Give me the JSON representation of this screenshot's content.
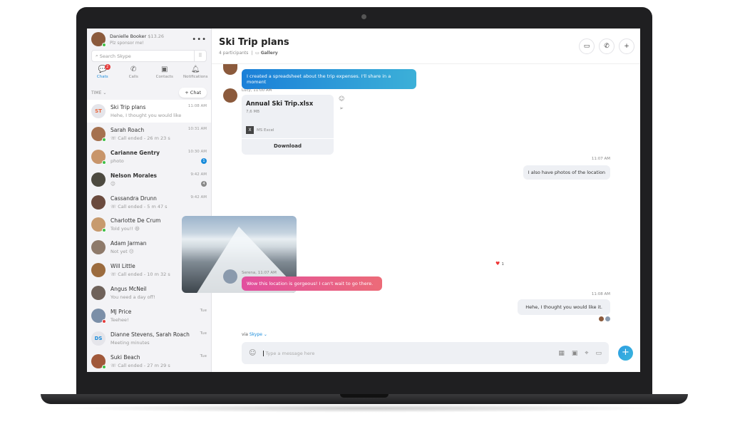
{
  "profile": {
    "name": "Danielle Booker",
    "balance": "$13.26",
    "mood": "Plz sponsor me!"
  },
  "search": {
    "placeholder": "Search Skype"
  },
  "tabs": [
    {
      "label": "Chats",
      "badge": "2"
    },
    {
      "label": "Calls"
    },
    {
      "label": "Contacts"
    },
    {
      "label": "Notifications"
    }
  ],
  "sort_label": "TIME",
  "new_chat_label": "+ Chat",
  "conversations": [
    {
      "name": "Ski Trip plans",
      "initials": "ST",
      "time": "11:08 AM",
      "preview": "Hehe, I thought you would like",
      "color": "#e5e5ea",
      "textcolor": "#e8663c"
    },
    {
      "name": "Sarah Roach",
      "time": "10:31 AM",
      "preview": "Call ended - 26 m 23 s",
      "color": "#a5714f",
      "status": "online"
    },
    {
      "name": "Carianne Gentry",
      "time": "10:30 AM",
      "preview": "photo",
      "unread": "1",
      "bold": true,
      "color": "#c8956a",
      "status": "online"
    },
    {
      "name": "Nelson Morales",
      "time": "9:42 AM",
      "preview": "😉",
      "unread": "4",
      "bold": true,
      "color": "#4d4a40"
    },
    {
      "name": "Cassandra Drunn",
      "time": "9:42 AM",
      "preview": "Call ended - 5 m 47 s",
      "color": "#6b4b3e"
    },
    {
      "name": "Charlotte De Crum",
      "time": "Wed",
      "preview": "Told you!! 😆",
      "color": "#c79a6e",
      "status": "online"
    },
    {
      "name": "Adam Jarman",
      "time": "Wed",
      "preview": "Not yet 😐",
      "color": "#8e7a6a"
    },
    {
      "name": "Will Little",
      "time": "Wed",
      "preview": "Call ended - 10 m 32 s",
      "color": "#9b6b3e"
    },
    {
      "name": "Angus McNeil",
      "time": "Wed",
      "preview": "You need a day off!",
      "color": "#6f625a"
    },
    {
      "name": "MJ Price",
      "time": "Tue",
      "preview": "Teehee!",
      "color": "#7b8fa8",
      "status": "busy"
    },
    {
      "name": "Dianne Stevens, Sarah Roach",
      "initials": "DS",
      "time": "Tue",
      "preview": "Meeting minutes",
      "color": "#e5e5ea",
      "textcolor": "#1a8cdb"
    },
    {
      "name": "Suki Beach",
      "time": "Tue",
      "preview": "Call ended - 27 m 29 s",
      "color": "#a0583a",
      "status": "online"
    }
  ],
  "chat": {
    "title": "Ski Trip plans",
    "participants": "4 participants",
    "gallery": "Gallery",
    "msg1": {
      "text": "I created a spreadsheet about the trip expenses. I'll share in a moment"
    },
    "file": {
      "meta": "Lucy, 11:00 AM",
      "name": "Annual Ski Trip.xlsx",
      "size": "7,6 MB",
      "type": "MS Excel",
      "download": "Download"
    },
    "msg2": {
      "time": "11:07 AM",
      "text": "I also have photos of the location"
    },
    "reaction": {
      "icon": "heart",
      "count": "1"
    },
    "msg3": {
      "meta": "Serena, 11:07 AM",
      "text": "Wow this location is gorgeous! I can't wait to go there."
    },
    "msg4": {
      "time": "11:08 AM",
      "text": "Hehe, I thought you would like it."
    },
    "via": "via",
    "via_link": "Skype",
    "compose_placeholder": "Type a message here"
  },
  "colors": {
    "accent": "#1a8cdb"
  }
}
